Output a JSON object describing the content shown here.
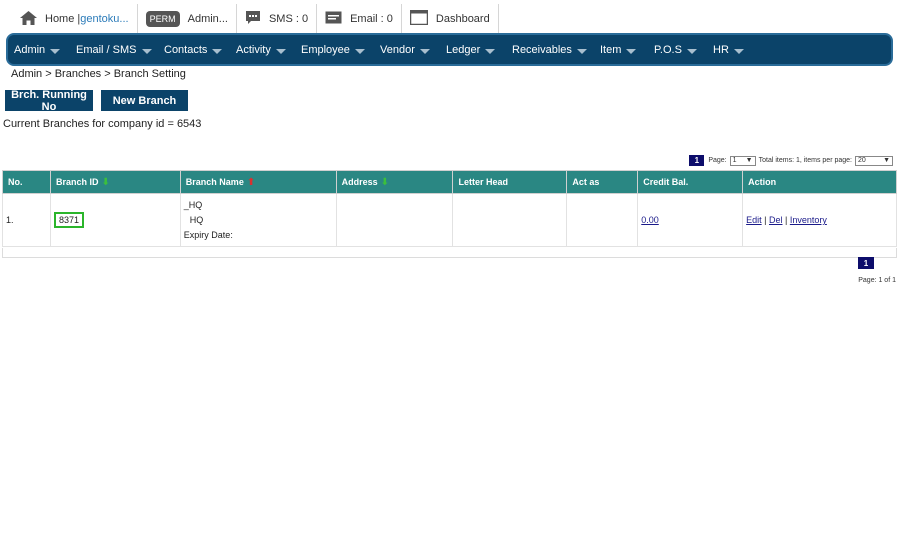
{
  "topbar": {
    "home_label": "Home | ",
    "home_user": "gentoku...",
    "perm_badge": "PERM",
    "admin_label": "Admin...",
    "sms_label": "SMS : 0",
    "email_label": "Email : 0",
    "dashboard_label": "Dashboard"
  },
  "nav": {
    "items": [
      "Admin",
      "Email / SMS",
      "Contacts",
      "Activity",
      "Employee",
      "Vendor",
      "Ledger",
      "Receivables",
      "Item",
      "P.O.S",
      "HR"
    ]
  },
  "breadcrumb": "Admin > Branches > Branch Setting",
  "buttons": {
    "running_no": "Brch. Running No",
    "new_branch": "New Branch"
  },
  "company_line": "Current Branches for company id = 6543",
  "pager": {
    "current_page": "1",
    "page_label": "Page:",
    "page_select": "1",
    "total_label": "Total items: 1, items per page:",
    "per_page": "20",
    "page_of": "Page: 1 of 1"
  },
  "table": {
    "headers": [
      "No.",
      "Branch ID",
      "Branch Name",
      "Address",
      "Letter Head",
      "Act as",
      "Credit Bal.",
      "Action"
    ],
    "rows": [
      {
        "no": "1.",
        "branch_id": "8371",
        "branch_name_line1": "_HQ",
        "branch_name_line2": "HQ",
        "branch_name_line3": "Expiry Date:",
        "address": "",
        "letter_head": "",
        "act_as": "",
        "credit_bal": "0.00",
        "action_edit": "Edit",
        "action_del": "Del",
        "action_inventory": "Inventory",
        "action_sep": " | "
      }
    ]
  },
  "colors": {
    "nav_bg": "#0b4369",
    "header_bg": "#2a8783",
    "page_box": "#0d0d6b",
    "highlight": "#2bb52b"
  }
}
